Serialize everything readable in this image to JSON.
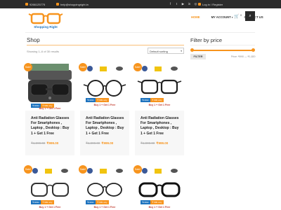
{
  "topbar": {
    "phone": "9266125775",
    "email": "help@shoppingright.in",
    "socials": [
      "f",
      "t",
      "▶",
      "in",
      "◎"
    ],
    "login": "Log in / Register"
  },
  "brand": "Shopping Right",
  "nav": {
    "home": "HOME",
    "account": "MY ACCOUNT",
    "contact": "CONTACT US",
    "cart_count": "0"
  },
  "shop": {
    "title": "Shop",
    "result_count": "Showing 1–6 of 30 results",
    "ordering": "Default sorting"
  },
  "sidebar": {
    "title": "Filter by price",
    "button": "FILTER",
    "price_range": "Price: ₹990 — ₹1,820"
  },
  "products": [
    {
      "sale": "Sale!",
      "name": "Anti Radiation Glasses For Smartphones , Laptop , Desktop : Buy 1 + Get 1 Free",
      "old_price": "₹1,999.00",
      "new_price": "₹999.00",
      "tag1": "₹1999/-",
      "tag2": "₹ 999 only",
      "offer": "Buy 1 + Get 1 Free"
    },
    {
      "sale": "Sale!",
      "name": "Anti Radiation Glasses For Smartphones , Laptop , Desktop : Buy 1 + Get 1 Free",
      "old_price": "₹1,999.00",
      "new_price": "₹999.00",
      "tag1": "₹1999/-",
      "tag2": "₹ 999 only",
      "offer": "Buy 1 + Get 1 Free"
    },
    {
      "sale": "Sale!",
      "name": "Anti Radiation Glasses For Smartphones , Laptop , Desktop : Buy 1 + Get 1 Free",
      "old_price": "₹1,999.00",
      "new_price": "₹999.00",
      "tag1": "₹1999/-",
      "tag2": "₹ 999 only",
      "offer": "Buy 1 + Get 1 Free"
    },
    {
      "sale": "Sale!",
      "tag1": "₹1999/-",
      "tag2": "₹ 999 only",
      "offer": "Buy 1 + Get 1 Free"
    },
    {
      "sale": "Sale!",
      "tag1": "₹1999/-",
      "tag2": "₹ 999 only",
      "offer": "Buy 1 + Get 1 Free"
    },
    {
      "sale": "Sale!",
      "tag1": "₹1999/-",
      "tag2": "₹ 999 only",
      "offer": "Buy 1 + Get 1 Free"
    }
  ],
  "price_filter": {
    "min_fraction": 0,
    "max_fraction": 1
  },
  "colors": {
    "accent": "#f7941d",
    "brand_blue": "#1e73be",
    "topbar": "#2b2b2b"
  }
}
